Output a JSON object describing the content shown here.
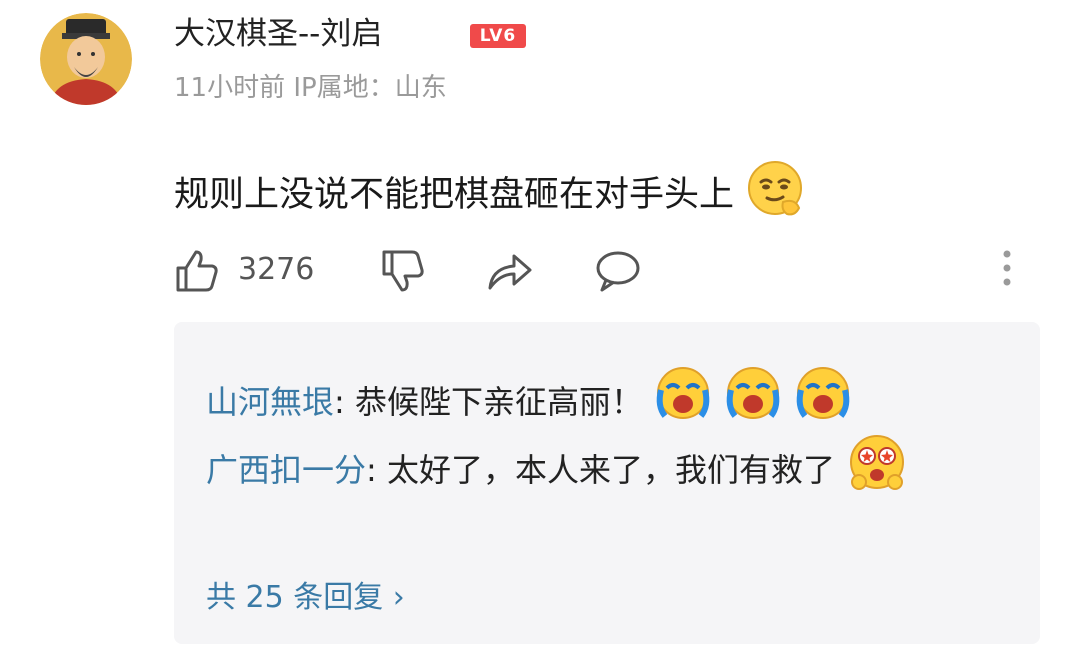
{
  "comment": {
    "username": "大汉棋圣--刘启",
    "level_badge": "LV6",
    "time": "11小时前",
    "ip_location": "IP属地：山东",
    "text": "规则上没说不能把棋盘砸在对手头上",
    "emoji": "smirk-emoji",
    "likes": "3276"
  },
  "replies": [
    {
      "name": "山河無垠",
      "separator": ": ",
      "text": "恭候陛下亲征高丽！",
      "emoji": "crying-emoji"
    },
    {
      "name": "广西扣一分",
      "separator": ": ",
      "text": "太好了，本人来了，我们有救了",
      "emoji": "amazed-emoji"
    }
  ],
  "total_replies": "共 25 条回复",
  "chevron": "›",
  "colors": {
    "link_blue": "#3a7aa6",
    "badge_red": "#f04a4a",
    "meta_grey": "#9a9a9a",
    "reply_bg": "#f5f5f7"
  }
}
